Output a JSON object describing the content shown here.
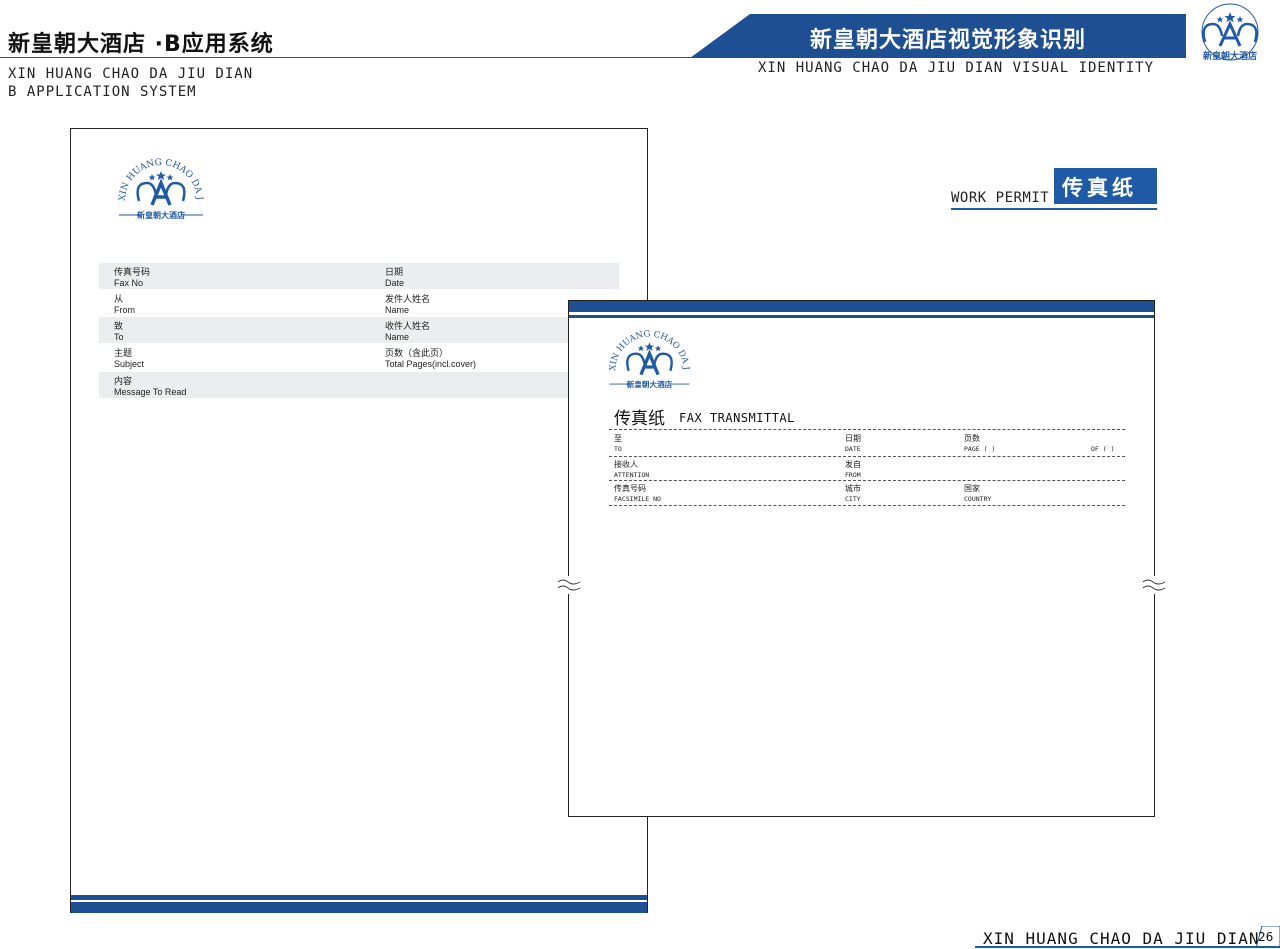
{
  "header": {
    "title": "新皇朝大酒店 ·B应用系统",
    "sub_line1": "XIN HUANG CHAO DA JIU DIAN",
    "sub_line2": "B APPLICATION SYSTEM",
    "banner_title": "新皇朝大酒店视觉形象识别",
    "banner_sub": "XIN HUANG CHAO DA JIU DIAN VISUAL IDENTITY"
  },
  "logo": {
    "arc_text": "XIN HUANG CHAO DA JIU DIAN",
    "name": "新皇朝大酒店"
  },
  "colors": {
    "brand_blue": "#1e4f93",
    "accent_blue": "#1f5aa6",
    "row_shade": "#ecedee"
  },
  "section": {
    "label_en": "WORK PERMIT",
    "label_cn": "传真纸"
  },
  "letterhead": {
    "rows": [
      {
        "l_cn": "传真号码",
        "l_en": "Fax No",
        "r_cn": "日期",
        "r_en": "Date"
      },
      {
        "l_cn": "从",
        "l_en": "From",
        "r_cn": "发件人姓名",
        "r_en": "Name"
      },
      {
        "l_cn": "致",
        "l_en": "To",
        "r_cn": "收件人姓名",
        "r_en": "Name"
      },
      {
        "l_cn": "主题",
        "l_en": "Subject",
        "r_cn": "页数（含此页）",
        "r_en": "Total Pages(incl.cover)"
      },
      {
        "l_cn": "内容",
        "l_en": "Message To Read",
        "r_cn": "",
        "r_en": ""
      }
    ]
  },
  "fax": {
    "title_cn": "传真纸",
    "title_en": "FAX TRANSMITTAL",
    "row1": {
      "c1_cn": "至",
      "c1_en": "TO",
      "c2_cn": "日期",
      "c2_en": "DATE",
      "c3_cn": "页数",
      "c3_en": "PAGE (   )",
      "c4_en": "OF (   )"
    },
    "row2": {
      "c1_cn": "接收人",
      "c1_en": "ATTENTION",
      "c2_cn": "发自",
      "c2_en": "FROM"
    },
    "row3": {
      "c1_cn": "传真号码",
      "c1_en": "FACSIMILE NO",
      "c2_cn": "城市",
      "c2_en": "CITY",
      "c3_cn": "国家",
      "c3_en": "COUNTRY"
    }
  },
  "footer": {
    "text": "XIN HUANG CHAO DA JIU DIAN",
    "page": "26"
  }
}
